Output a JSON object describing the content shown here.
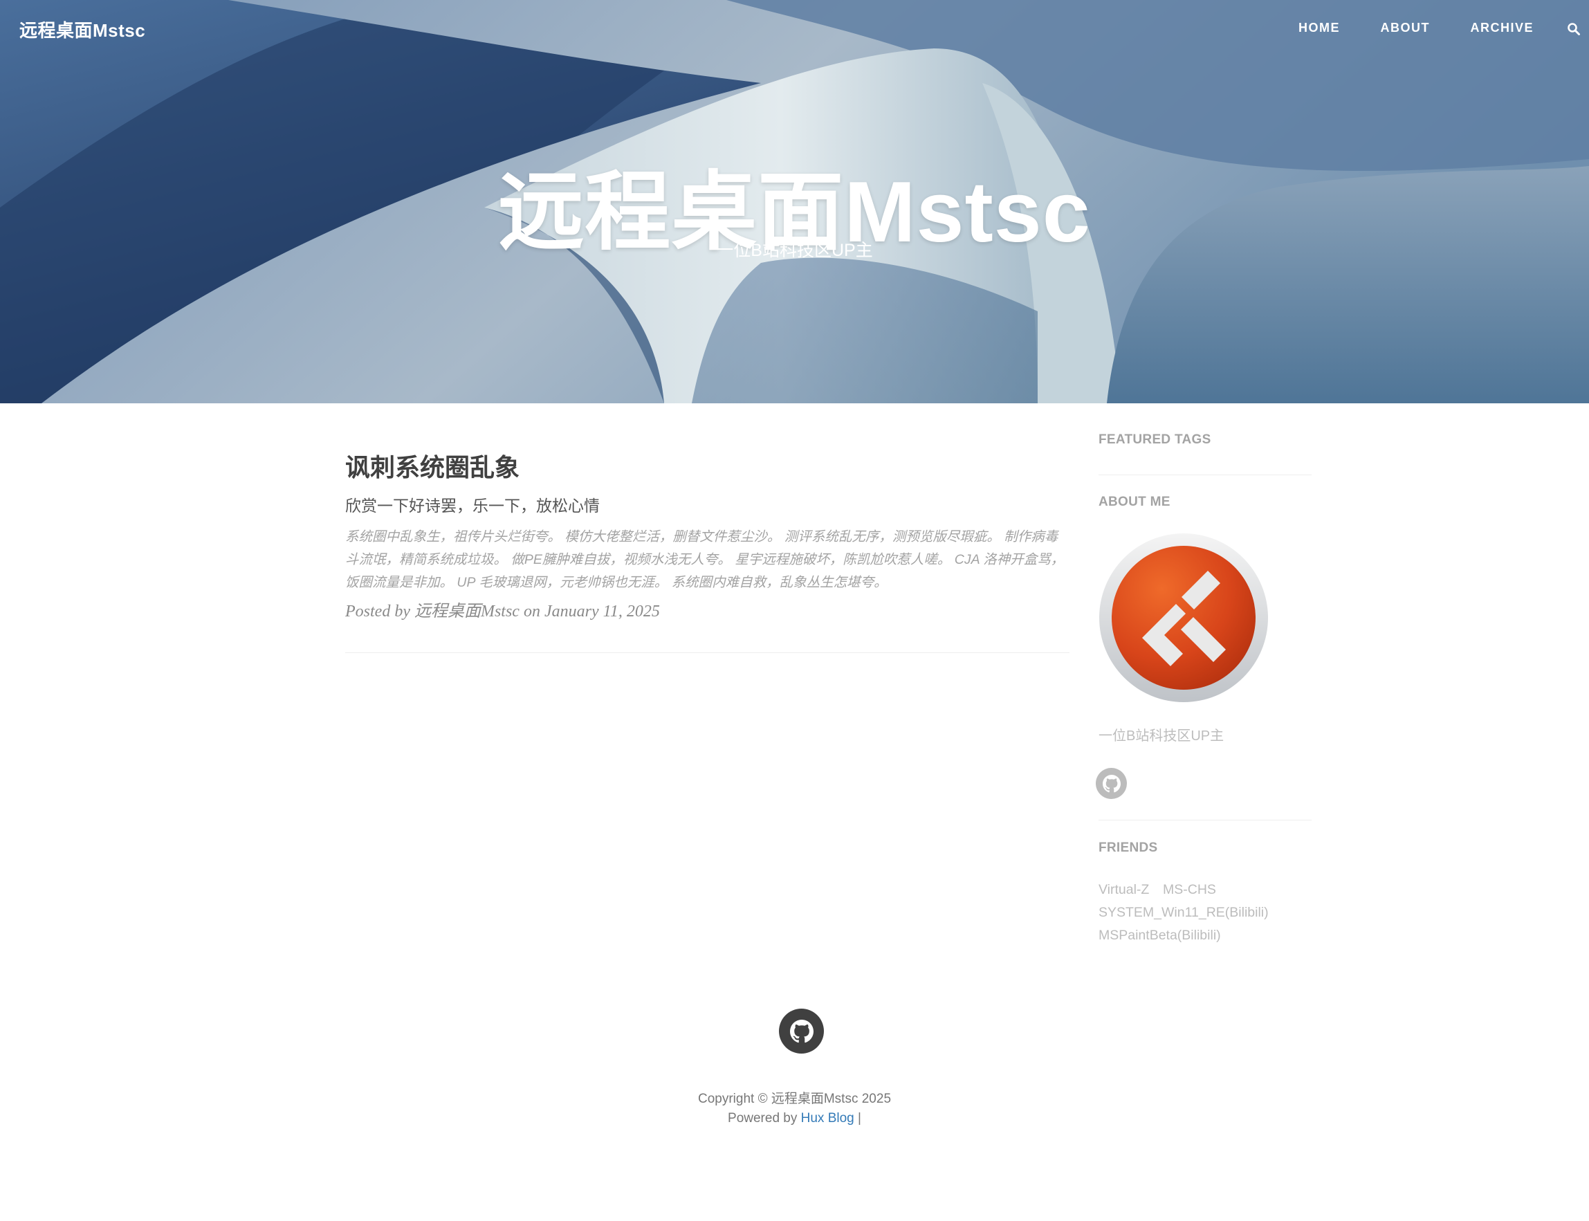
{
  "nav": {
    "brand": "远程桌面Mstsc",
    "items": [
      "HOME",
      "ABOUT",
      "ARCHIVE"
    ],
    "search_icon": "search-icon"
  },
  "hero": {
    "title": "远程桌面Mstsc",
    "subtitle": "一位B站科技区UP主"
  },
  "post": {
    "title": "讽刺系统圈乱象",
    "subtitle": "欣赏一下好诗罢，乐一下，放松心情",
    "excerpt": "系统圈中乱象生，祖传片头烂街夸。 模仿大佬整烂活，删替文件惹尘沙。 测评系统乱无序，测预览版尽瑕疵。 制作病毒斗流氓，精简系统成垃圾。 做PE臃肿难自拔，视频水浅无人夸。 星宇远程施破坏，陈凯尬吹惹人嗟。 CJA 洛神开盒骂，饭圈流量是非加。 UP 毛玻璃退网，元老帅锅也无涯。 系统圈内难自救，乱象丛生怎堪夸。",
    "meta": "Posted by 远程桌面Mstsc on January 11, 2025"
  },
  "sidebar": {
    "featured_tags_heading": "FEATURED TAGS",
    "about_heading": "ABOUT ME",
    "about_text": "一位B站科技区UP主",
    "friends_heading": "FRIENDS",
    "friends": [
      "Virtual-Z",
      "MS-CHS",
      "SYSTEM_Win11_RE(Bilibili)",
      "MSPaintBeta(Bilibili)"
    ]
  },
  "footer": {
    "copyright": "Copyright © 远程桌面Mstsc 2025",
    "powered_prefix": "Powered by ",
    "powered_link": "Hux Blog",
    "powered_suffix": " |"
  },
  "colors": {
    "accent_link": "#337ab7",
    "avatar_orange": "#d94a1a",
    "text_dark": "#404040",
    "text_muted": "#a3a3a3"
  }
}
